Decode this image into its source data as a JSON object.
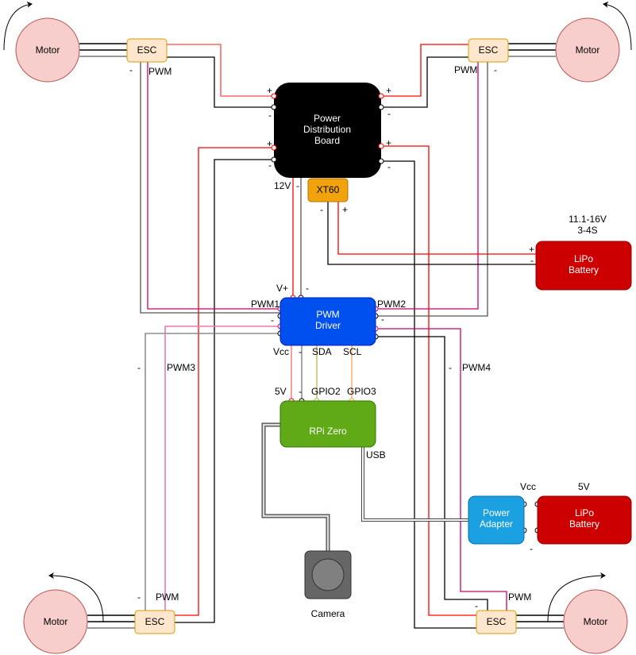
{
  "components": {
    "motor": "Motor",
    "esc": "ESC",
    "pdb": [
      "Power",
      "Distribution",
      "Board"
    ],
    "xt60": "XT60",
    "lipo_main": [
      "LiPo",
      "Battery"
    ],
    "lipo_main_spec": [
      "11.1-16V",
      "3-4S"
    ],
    "pwm_driver": [
      "PWM",
      "Driver"
    ],
    "rpi": "RPi Zero",
    "power_adapter": [
      "Power",
      "Adapter"
    ],
    "lipo_small": [
      "LiPo",
      "Battery"
    ],
    "camera": "Camera"
  },
  "labels": {
    "plus": "+",
    "minus": "-",
    "pwm": "PWM",
    "v12": "12V",
    "vplus": "V+",
    "pwm1": "PWM1",
    "pwm2": "PWM2",
    "pwm3": "PWM3",
    "pwm4": "PWM4",
    "vcc": "Vcc",
    "sda": "SDA",
    "scl": "SCL",
    "v5": "5V",
    "gpio2": "GPIO2",
    "gpio3": "GPIO3",
    "usb": "USB"
  },
  "colors": {
    "motor_fill": "#f8cecc",
    "motor_stroke": "#b85450",
    "esc_fill": "#ffe6cc",
    "esc_stroke": "#d79b00",
    "pdb": "#000000",
    "xt60": "#f0a30a",
    "lipo": "#cc0000",
    "pwm_driver": "#0050ef",
    "rpi": "#60a917",
    "power_adapter": "#1ba1e2",
    "camera": "#666666",
    "wire_pos": "#ff0000",
    "wire_pwm": "#cc0066"
  }
}
